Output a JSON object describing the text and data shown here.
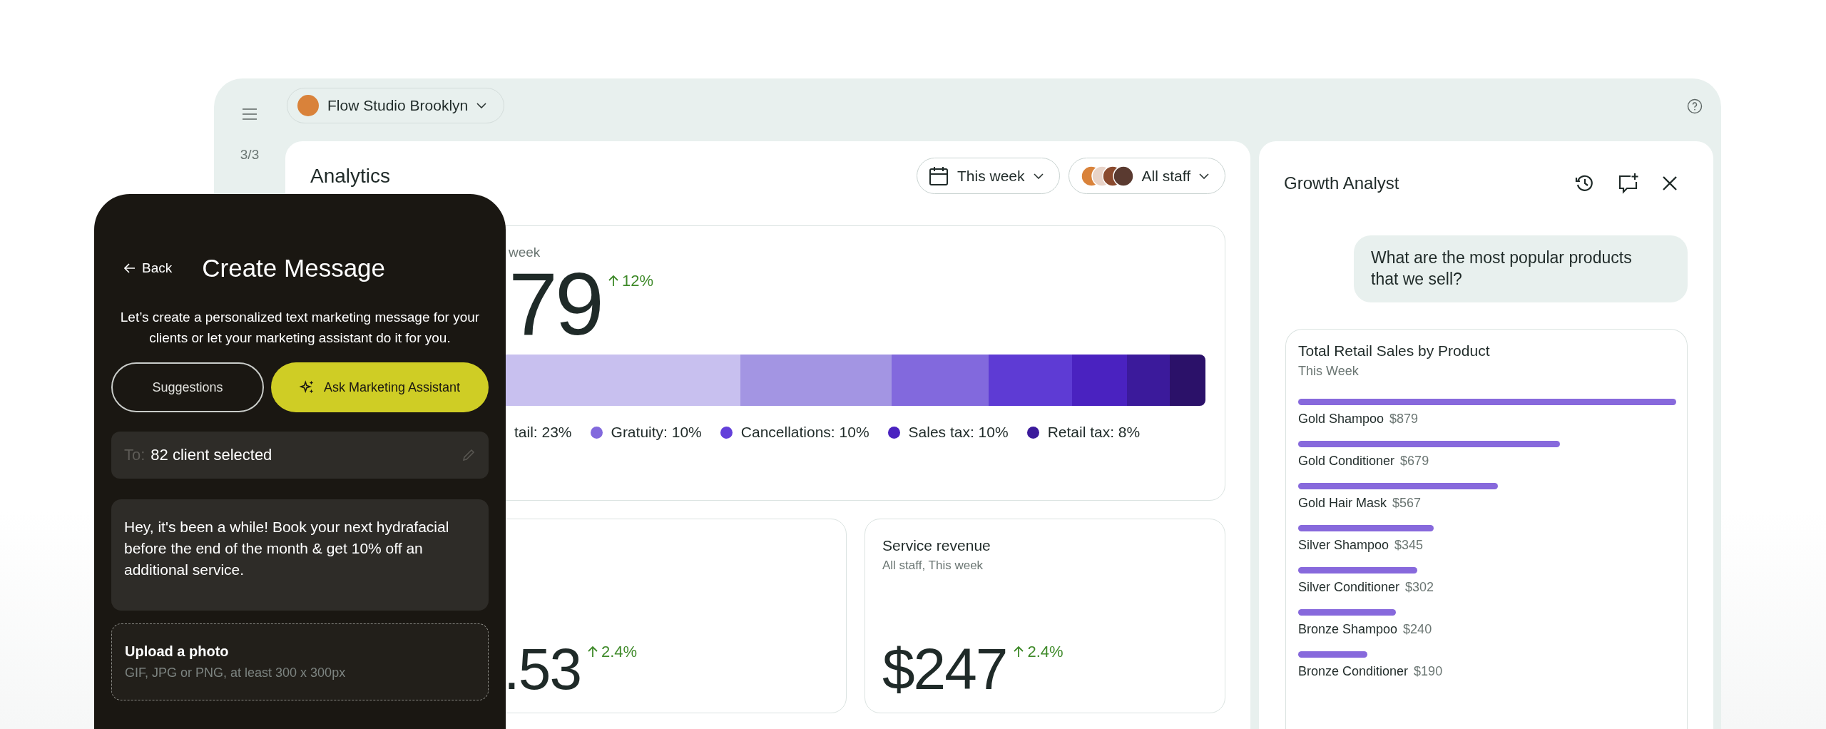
{
  "app": {
    "location": "Flow Studio Brooklyn",
    "page_counter": "3/3"
  },
  "analytics": {
    "title": "Analytics",
    "filters": [
      {
        "kind": "date",
        "label": "This week"
      },
      {
        "kind": "staff",
        "label": "All staff"
      }
    ],
    "summary": {
      "subtitle": "week",
      "value": "79",
      "change": "12%",
      "segments": [
        {
          "color": "#c8c0ef"
        },
        {
          "color": "#a395e3"
        },
        {
          "color": "#8269dd"
        },
        {
          "color": "#5e3bd4"
        },
        {
          "color": "#4a22c0"
        },
        {
          "color": "#3b1a9b"
        },
        {
          "color": "#2b1169"
        }
      ],
      "legend": [
        {
          "label": "tail: 23%"
        },
        {
          "label": "Gratuity: 10%",
          "color": "#8269dd"
        },
        {
          "label": "Cancellations: 10%",
          "color": "#6340da"
        },
        {
          "label": "Sales tax: 10%",
          "color": "#4a22c0"
        },
        {
          "label": "Retail tax: 8%",
          "color": "#3b1a9b"
        }
      ]
    },
    "cards": [
      {
        "value": ".53",
        "change": "2.4%"
      },
      {
        "title": "Service revenue",
        "subtitle": "All staff, This week",
        "value": "$247",
        "change": "2.4%"
      }
    ]
  },
  "assistant": {
    "title": "Growth Analyst",
    "question": "What are the most popular products that we sell?",
    "result": {
      "title": "Total Retail Sales by Product",
      "subtitle": "This Week",
      "items": [
        {
          "name": "Gold Shampoo",
          "value": "$879"
        },
        {
          "name": "Gold Conditioner",
          "value": "$679"
        },
        {
          "name": "Gold Hair Mask",
          "value": "$567"
        },
        {
          "name": "Silver Shampoo",
          "value": "$345"
        },
        {
          "name": "Silver Conditioner",
          "value": "$302"
        },
        {
          "name": "Bronze Shampoo",
          "value": "$240"
        },
        {
          "name": "Bronze Conditioner",
          "value": "$190"
        }
      ]
    }
  },
  "composer": {
    "back": "Back",
    "title": "Create Message",
    "description": "Let’s create a personalized text marketing message for your clients or let your marketing assistant do it for you.",
    "buttons": [
      {
        "kind": "outline",
        "label": "Suggestions"
      },
      {
        "kind": "primary",
        "label": "Ask Marketing Assistant"
      }
    ],
    "to_label": "To:",
    "recipients": "82 client selected",
    "message": "Hey, it's been a while! Book your next hydrafacial before the end of the month & get 10% off an additional service.",
    "upload": {
      "title": "Upload a photo",
      "hint": "GIF, JPG or PNG, at least 300 x 300px"
    }
  }
}
